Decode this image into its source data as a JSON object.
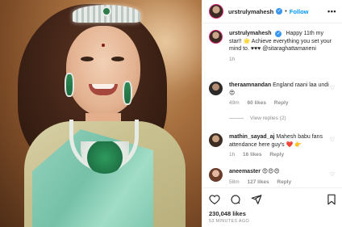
{
  "post": {
    "username": "urstrulymahesh",
    "follow_label": "Follow",
    "caption": "Happy 11th my star!! 🌟 Achieve everything you set your mind to. ♥♥♥ @sitaraghattamaneni",
    "caption_age": "1h"
  },
  "comments": [
    {
      "user": "theraamnandan",
      "text": "England raani laa undi 😍",
      "age": "49m",
      "likes": "60 likes",
      "reply": "Reply"
    },
    {
      "user": "mathin_sayad_aj",
      "text": "Mahesh babu fans attendance here guy's ❤️ 👉",
      "age": "1h",
      "likes": "16 likes",
      "reply": "Reply"
    },
    {
      "user": "aneemaster",
      "text": "😍😍😍",
      "age": "58m",
      "likes": "127 likes",
      "reply": "Reply"
    }
  ],
  "view_replies": "View replies (2)",
  "footer": {
    "likes": "230,048 likes",
    "timestamp": "53 MINUTES AGO"
  },
  "icons": [
    "verified-badge",
    "more-icon",
    "heart-icon",
    "comment-icon",
    "share-icon",
    "bookmark-icon"
  ],
  "colors": {
    "accent": "#0095f6",
    "verified": "#3897f0",
    "muted": "#8e8e8e"
  }
}
